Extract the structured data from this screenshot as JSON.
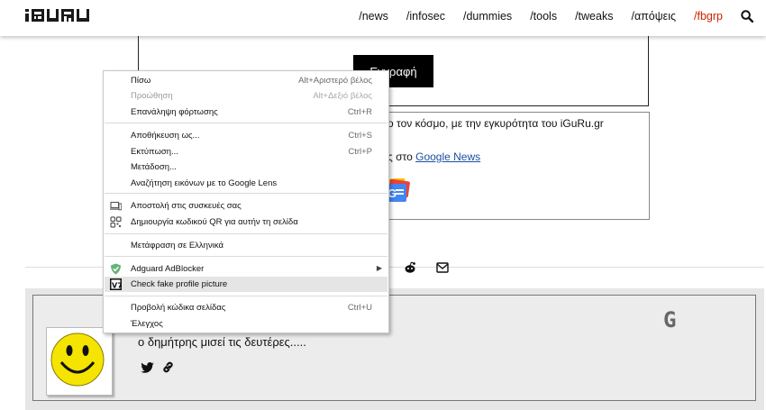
{
  "nav": {
    "logo": "iGURU",
    "links": [
      "/news",
      "/infosec",
      "/dummies",
      "/tools",
      "/tweaks",
      "/απόψεις",
      "/fbgrp"
    ],
    "accent_color": "#cc2200"
  },
  "page": {
    "subscribe_button": "Εγγραφή",
    "box_line1": "ο τον κόσμο, με την εγκυρότητα του iGuRu.gr",
    "box_line2_prefix": "ς στο ",
    "google_news_link": "Google News",
    "comment_text": "ο δημήτρης μισεί τις δευτέρες.....",
    "comment_g_badge": "G"
  },
  "context_menu": {
    "items": [
      {
        "label": "Πίσω",
        "shortcut": "Alt+Αριστερό βέλος",
        "disabled": false
      },
      {
        "label": "Προώθηση",
        "shortcut": "Alt+Δεξιό βέλος",
        "disabled": true
      },
      {
        "label": "Επανάληψη φόρτωσης",
        "shortcut": "Ctrl+R",
        "disabled": false
      },
      {
        "label": "Αποθήκευση ως...",
        "shortcut": "Ctrl+S",
        "disabled": false
      },
      {
        "label": "Εκτύπωση...",
        "shortcut": "Ctrl+P",
        "disabled": false
      },
      {
        "label": "Μετάδοση...",
        "shortcut": "",
        "disabled": false
      },
      {
        "label": "Αναζήτηση εικόνων με το Google Lens",
        "shortcut": "",
        "disabled": false
      },
      {
        "label": "Αποστολή στις συσκευές σας",
        "shortcut": "",
        "disabled": false,
        "icon": "devices-icon"
      },
      {
        "label": "Δημιουργία κωδικού QR για αυτήν τη σελίδα",
        "shortcut": "",
        "disabled": false,
        "icon": "qr-code-icon"
      },
      {
        "label": "Μετάφραση σε Ελληνικά",
        "shortcut": "",
        "disabled": false
      },
      {
        "label": "Adguard AdBlocker",
        "shortcut": "",
        "disabled": false,
        "icon": "adguard-shield-icon",
        "submenu": true
      },
      {
        "label": "Check fake profile picture",
        "shortcut": "",
        "disabled": false,
        "icon": "v7-extension-icon",
        "highlighted": true
      },
      {
        "label": "Προβολή κώδικα σελίδας",
        "shortcut": "Ctrl+U",
        "disabled": false
      },
      {
        "label": "Έλεγχος",
        "shortcut": "",
        "disabled": false
      }
    ]
  }
}
